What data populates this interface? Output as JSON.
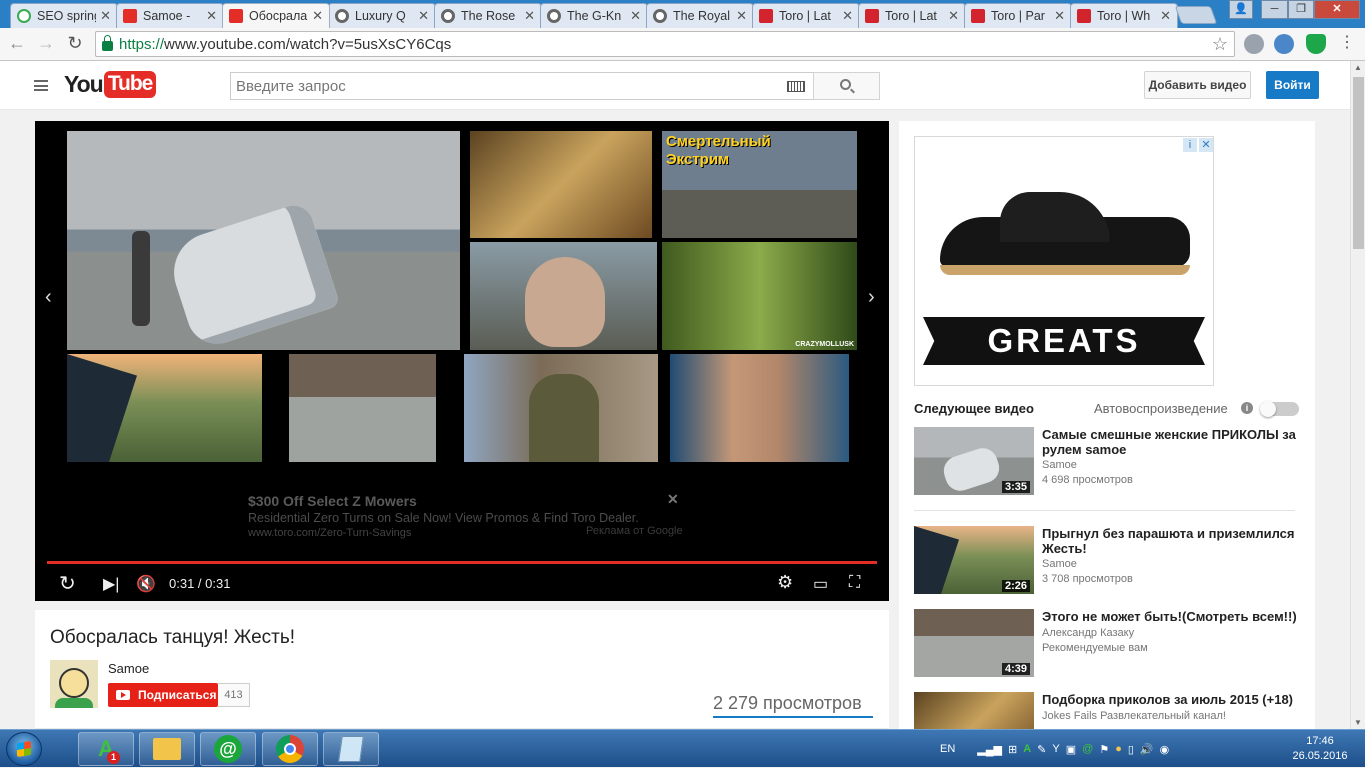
{
  "browser": {
    "tabs": [
      {
        "title": "SEO spring",
        "icon": "seo-icon"
      },
      {
        "title": "Samoe - ",
        "icon": "youtube-icon"
      },
      {
        "title": "Обосрала",
        "icon": "youtube-icon",
        "active": true
      },
      {
        "title": "Luxury Q",
        "icon": "google-icon"
      },
      {
        "title": "The Rose",
        "icon": "google-icon"
      },
      {
        "title": "The G-Kn",
        "icon": "google-icon"
      },
      {
        "title": "The Royal",
        "icon": "google-icon"
      },
      {
        "title": "Toro | Lat",
        "icon": "toro-icon"
      },
      {
        "title": "Toro | Lat",
        "icon": "toro-icon"
      },
      {
        "title": "Toro | Par",
        "icon": "toro-icon"
      },
      {
        "title": "Toro | Wh",
        "icon": "toro-icon"
      }
    ],
    "url_scheme": "https://",
    "url_rest": "www.youtube.com/watch?v=5usXsCY6Cqs"
  },
  "youtube": {
    "logo_you": "You",
    "logo_tube": "Tube",
    "search_placeholder": "Введите запрос",
    "upload_label": "Добавить видео",
    "signin_label": "Войти"
  },
  "player": {
    "thumb_overlay_1": "Смертельный Экстрим",
    "thumb_overlay_2": "CRAZYMOLLUSK",
    "ad": {
      "title": "$300 Off Select Z Mowers",
      "description": "Residential Zero Turns on Sale Now! View Promos & Find Toro Dealer.",
      "url": "www.toro.com/Zero-Turn-Savings",
      "by": "Реклама от Google",
      "close": "✕"
    },
    "time": "0:31 / 0:31",
    "progress": 1.0
  },
  "video": {
    "title": "Обосралась танцуя! Жесть!",
    "channel": "Samoe",
    "subscribe_label": "Подписаться",
    "subscriber_count": "413",
    "views": "2 279 просмотров"
  },
  "sidebar": {
    "ad_brand": "GREATS",
    "up_next": "Следующее видео",
    "autoplay": "Автовоспроизведение",
    "recommendations": [
      {
        "title": "Самые смешные женские ПРИКОЛЫ за рулем samoe",
        "channel": "Samoe",
        "views": "4 698 просмотров",
        "duration": "3:35"
      },
      {
        "title": "Прыгнул без парашюта и приземлился Жесть!",
        "channel": "Samoe",
        "views": "3 708 просмотров",
        "duration": "2:26"
      },
      {
        "title": "Этого не может быть!(Смотреть всем!!)",
        "channel": "Александр Казаку",
        "views": "Рекомендуемые вам",
        "duration": "4:39"
      },
      {
        "title": "Подборка приколов за июль 2015 (+18)",
        "channel": "Jokes Fails Развлекательный канал!",
        "views": "",
        "duration": ""
      }
    ]
  },
  "taskbar": {
    "language": "EN",
    "time": "17:46",
    "date": "26.05.2016",
    "badge": "1"
  }
}
